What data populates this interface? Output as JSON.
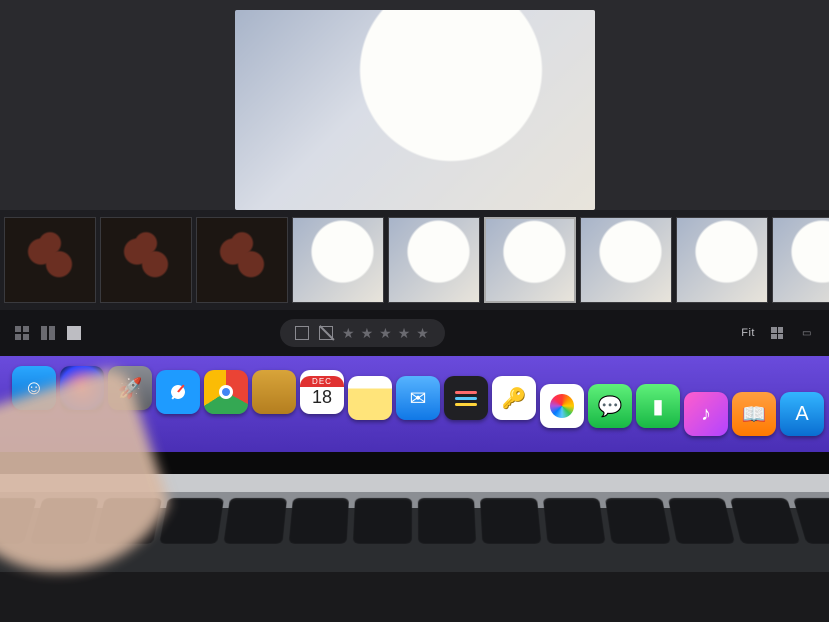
{
  "canvas": {
    "alt": "food-bowl-hero"
  },
  "filmstrip": {
    "thumbs": [
      {
        "variant": "dark",
        "selected": false
      },
      {
        "variant": "dark",
        "selected": false
      },
      {
        "variant": "dark",
        "selected": false
      },
      {
        "variant": "light",
        "selected": false
      },
      {
        "variant": "light",
        "selected": false
      },
      {
        "variant": "light",
        "selected": true
      },
      {
        "variant": "light",
        "selected": false
      },
      {
        "variant": "light",
        "selected": false
      },
      {
        "variant": "light",
        "selected": false
      },
      {
        "variant": "light",
        "selected": false
      }
    ]
  },
  "toolbar": {
    "rating_max": 5,
    "fit_label": "Fit"
  },
  "calendar": {
    "month": "DEC",
    "day": "18"
  },
  "dock": {
    "apps": [
      {
        "name": "finder",
        "bg": "linear-gradient(180deg,#2aa7ff,#0a6ed1)",
        "glyph": "☺"
      },
      {
        "name": "siri",
        "bg": "radial-gradient(circle at 50% 50%,#ff5ea0,#3344ff 70%,#111)",
        "glyph": ""
      },
      {
        "name": "launchpad",
        "bg": "linear-gradient(180deg,#8a8d93,#5c5f66)",
        "glyph": "🚀"
      },
      {
        "name": "safari",
        "bg": "radial-gradient(circle,#fff 0 22%,#1e9bff 24%)",
        "glyph": ""
      },
      {
        "name": "chrome",
        "bg": "conic-gradient(#ea4335 0 33%,#34a853 0 66%,#fbbc05 0)",
        "glyph": ""
      },
      {
        "name": "folder",
        "bg": "linear-gradient(180deg,#d8a43a,#b47e1f)",
        "glyph": ""
      },
      {
        "name": "calendar",
        "bg": "#fff",
        "glyph": ""
      },
      {
        "name": "notes",
        "bg": "linear-gradient(180deg,#fff 0 28%,#ffe47a 28%)",
        "glyph": ""
      },
      {
        "name": "mail",
        "bg": "linear-gradient(180deg,#56b3ff,#1078e6)",
        "glyph": "✉"
      },
      {
        "name": "reminders",
        "bg": "#202024",
        "glyph": ""
      },
      {
        "name": "terminal",
        "bg": "#fff",
        "glyph": "🔑"
      },
      {
        "name": "photos",
        "bg": "#fff",
        "glyph": "✿"
      },
      {
        "name": "messages",
        "bg": "linear-gradient(180deg,#5ff07a,#18b845)",
        "glyph": "💬"
      },
      {
        "name": "facetime",
        "bg": "linear-gradient(180deg,#5ff07a,#18b845)",
        "glyph": "▮"
      },
      {
        "name": "itunes",
        "bg": "linear-gradient(135deg,#ff5ecc,#b244ff)",
        "glyph": "♪"
      },
      {
        "name": "ibooks",
        "bg": "linear-gradient(180deg,#ff9f40,#ff7a00)",
        "glyph": "📖"
      },
      {
        "name": "appstore",
        "bg": "linear-gradient(180deg,#33b5ff,#0a6ed1)",
        "glyph": "A"
      }
    ]
  }
}
